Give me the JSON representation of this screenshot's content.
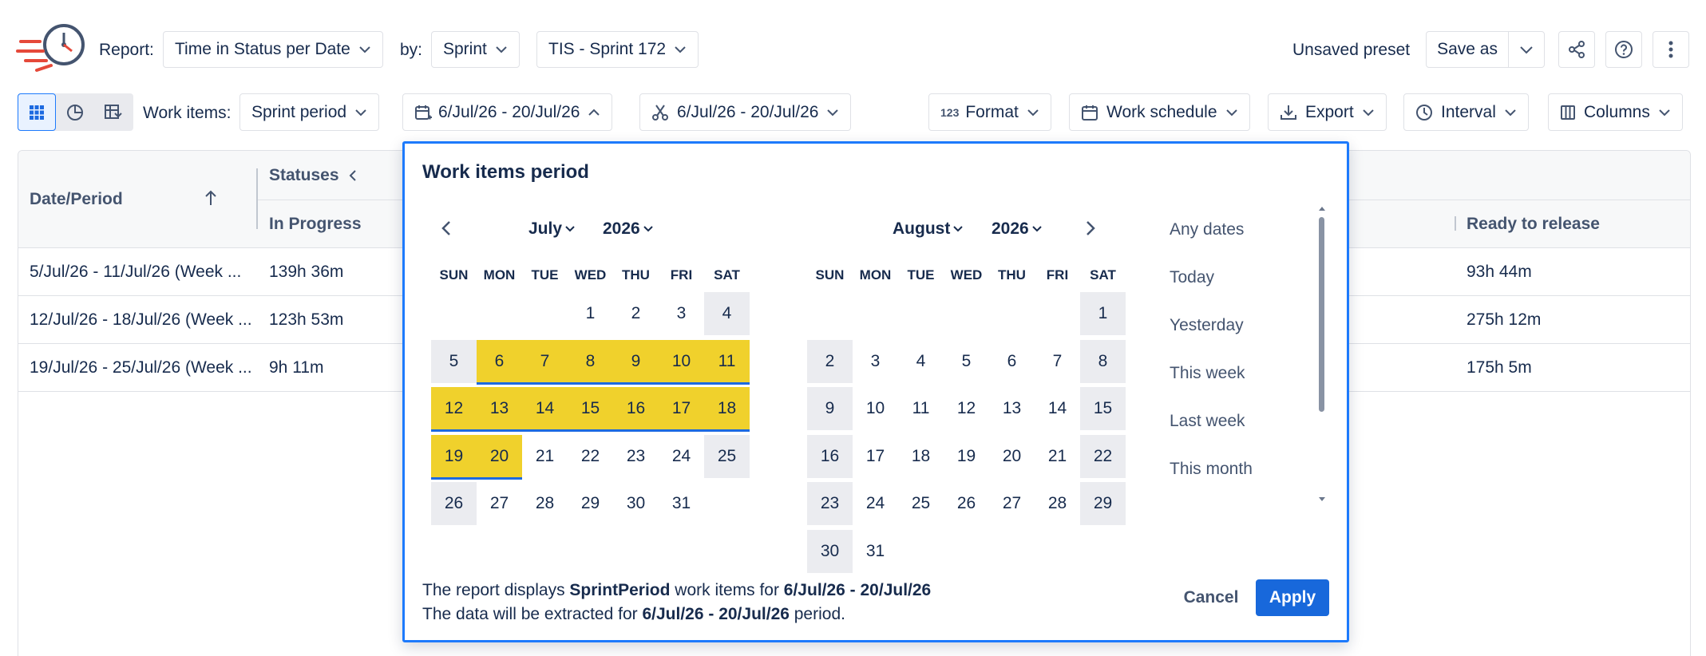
{
  "header": {
    "report_label": "Report:",
    "report_value": "Time in Status per Date",
    "by_label": "by:",
    "by_value": "Sprint",
    "sprint_value": "TIS - Sprint 172",
    "preset_status": "Unsaved preset",
    "save_as_label": "Save as"
  },
  "toolbar": {
    "work_items_label": "Work items:",
    "work_items_value": "Sprint period",
    "date_range": "6/Jul/26 - 20/Jul/26",
    "cut_range": "6/Jul/26 - 20/Jul/26",
    "format_label": "Format",
    "work_schedule_label": "Work schedule",
    "export_label": "Export",
    "interval_label": "Interval",
    "columns_label": "Columns"
  },
  "table": {
    "col_date_period": "Date/Period",
    "col_statuses": "Statuses",
    "col_in_progress": "In Progress",
    "col_ready_to_release": "Ready to release",
    "rows": [
      {
        "period": "5/Jul/26 - 11/Jul/26 (Week ...",
        "in_progress": "139h 36m",
        "ready": "93h 44m"
      },
      {
        "period": "12/Jul/26 - 18/Jul/26 (Week ...",
        "in_progress": "123h 53m",
        "ready": "275h 12m"
      },
      {
        "period": "19/Jul/26 - 25/Jul/26 (Week ...",
        "in_progress": "9h 11m",
        "ready": "175h 5m"
      }
    ]
  },
  "popup": {
    "title": "Work items period",
    "weekdays": [
      "SUN",
      "MON",
      "TUE",
      "WED",
      "THU",
      "FRI",
      "SAT"
    ],
    "left_month": "July",
    "left_year": "2026",
    "right_month": "August",
    "right_year": "2026",
    "presets": [
      "Any dates",
      "Today",
      "Yesterday",
      "This week",
      "Last week",
      "This month"
    ],
    "footer_line1_a": "The report displays ",
    "footer_line1_b": "SprintPeriod",
    "footer_line1_c": " work items for ",
    "footer_line1_d": "6/Jul/26 - 20/Jul/26",
    "footer_line2_a": "The data will be extracted for ",
    "footer_line2_b": "6/Jul/26 - 20/Jul/26",
    "footer_line2_c": " period.",
    "cancel_label": "Cancel",
    "apply_label": "Apply",
    "selected_range": {
      "start": "2026-07-06",
      "end": "2026-07-20"
    }
  },
  "colors": {
    "accent": "#1d7afc",
    "apply_bg": "#1868db",
    "selected_day": "#f0d12c",
    "weekend": "#ebecf0"
  }
}
